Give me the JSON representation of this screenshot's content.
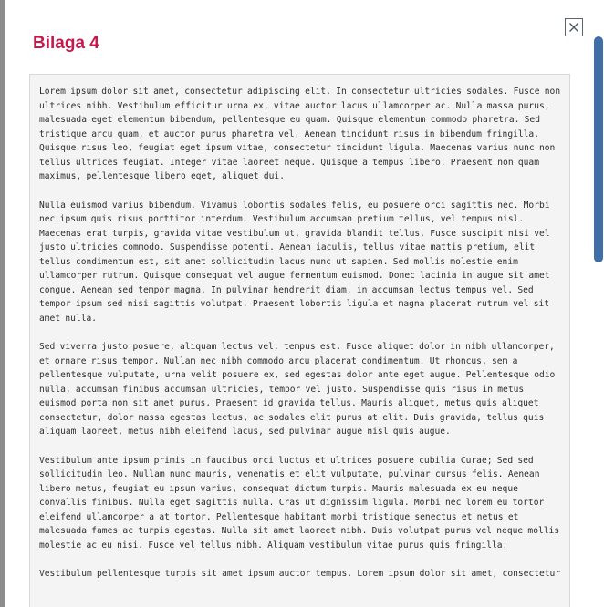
{
  "modal": {
    "title": "Bilaga 4",
    "close_icon": "close-x-icon",
    "paragraphs": [
      "Lorem ipsum dolor sit amet, consectetur adipiscing elit. In consectetur ultricies sodales. Fusce non ultrices nibh. Vestibulum efficitur urna ex, vitae auctor lacus ullamcorper ac. Nulla massa purus, malesuada eget elementum bibendum, pellentesque eu quam. Quisque elementum commodo pharetra. Sed tristique arcu quam, et auctor purus pharetra vel. Aenean tincidunt risus in bibendum fringilla. Quisque risus leo, feugiat eget ipsum vitae, consectetur tincidunt ligula. Maecenas varius nunc non tellus ultrices feugiat. Integer vitae laoreet neque. Quisque a tempus libero. Praesent non quam maximus, pellentesque libero eget, aliquet dui.",
      "Nulla euismod varius bibendum. Vivamus lobortis sodales felis, eu posuere orci sagittis nec. Morbi nec ipsum quis risus porttitor interdum. Vestibulum accumsan pretium tellus, vel tempus nisl. Maecenas erat turpis, gravida vitae vestibulum ut, gravida blandit tellus. Fusce suscipit nisi vel justo ultricies commodo. Suspendisse potenti. Aenean iaculis, tellus vitae mattis pretium, elit tellus condimentum est, sit amet sollicitudin lacus nunc ut sapien. Sed mollis molestie enim ullamcorper rutrum. Quisque consequat vel augue fermentum euismod. Donec lacinia in augue sit amet congue. Aenean sed tempor magna. In pulvinar hendrerit diam, in accumsan lectus tempus vel. Sed tempor ipsum sed nisi sagittis volutpat. Praesent lobortis ligula et magna placerat rutrum vel sit amet nulla.",
      "Sed viverra justo posuere, aliquam lectus vel, tempus est. Fusce aliquet dolor in nibh ullamcorper, et ornare risus tempor. Nullam nec nibh commodo arcu placerat condimentum. Ut rhoncus, sem a pellentesque vulputate, urna velit posuere ex, sed egestas dolor ante eget augue. Pellentesque odio nulla, accumsan finibus accumsan ultricies, tempor vel justo. Suspendisse quis risus in metus euismod porta non sit amet purus. Praesent id gravida tellus. Mauris aliquet, metus quis aliquet consectetur, dolor massa egestas lectus, ac sodales elit purus at elit. Duis gravida, tellus quis aliquam laoreet, metus nibh eleifend lacus, sed pulvinar augue nisl quis augue.",
      "Vestibulum ante ipsum primis in faucibus orci luctus et ultrices posuere cubilia Curae; Sed sed sollicitudin leo. Nullam nunc mauris, venenatis et elit vulputate, pulvinar cursus felis. Aenean libero metus, feugiat eu ipsum varius, consequat dictum turpis. Mauris malesuada ex eu neque convallis finibus. Nulla eget sagittis nulla. Cras ut dignissim ligula. Morbi nec lorem eu tortor eleifend ullamcorper a at tortor. Pellentesque habitant morbi tristique senectus et netus et malesuada fames ac turpis egestas. Nulla sit amet laoreet nibh. Duis volutpat purus vel neque mollis molestie ac eu nisi. Fusce vel tellus nibh. Aliquam vestibulum vitae purus quis fringilla.",
      "Vestibulum pellentesque turpis sit amet ipsum auctor tempus. Lorem ipsum dolor sit amet, consectetur"
    ]
  },
  "colors": {
    "title": "#c8174b",
    "scrollbar_thumb": "#3f6ea8",
    "content_background": "#f4f4f4"
  }
}
